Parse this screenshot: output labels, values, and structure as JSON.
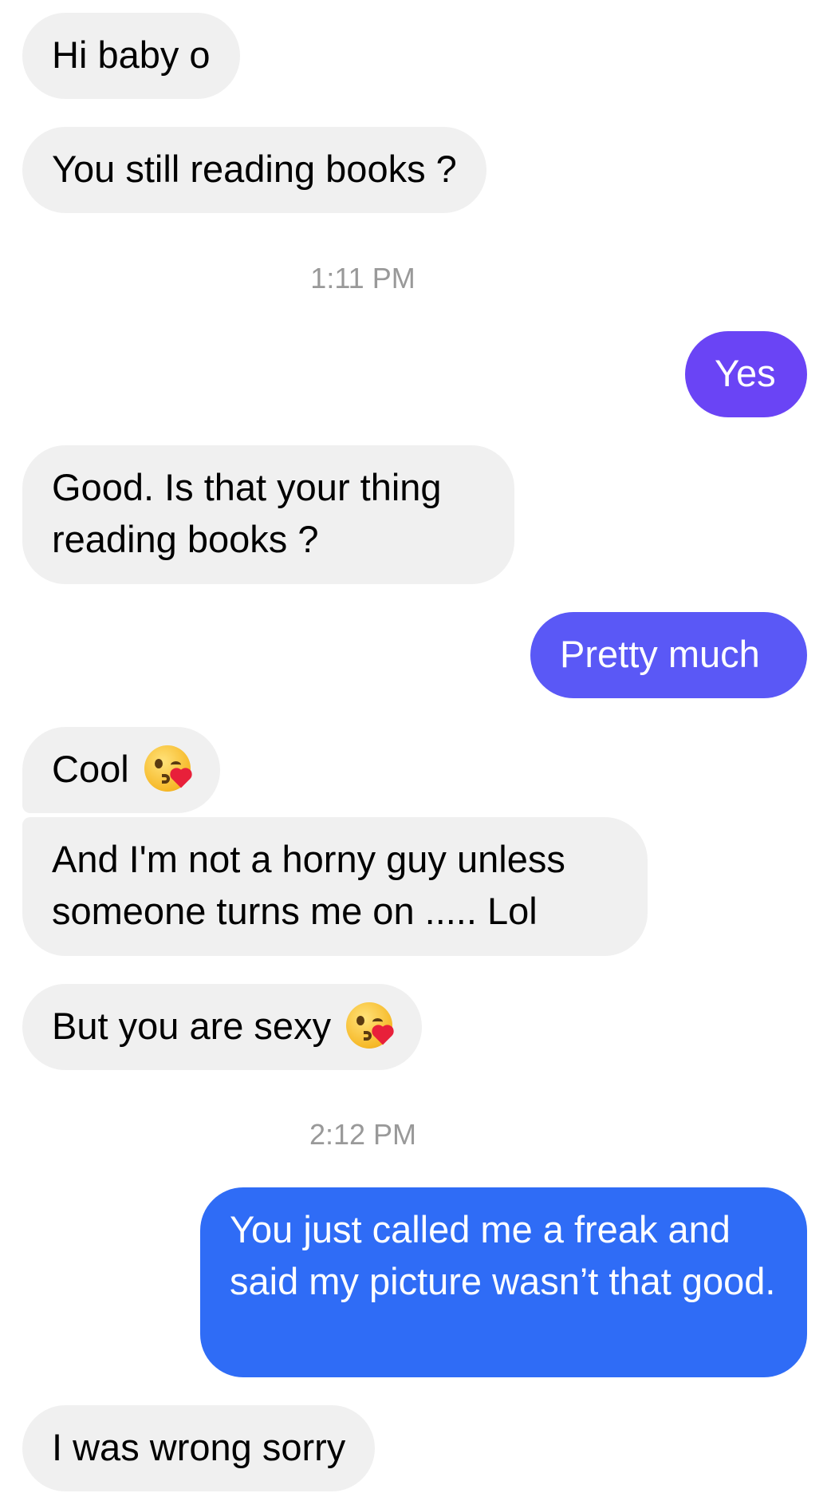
{
  "conversation": {
    "messages": [
      {
        "sender": "them",
        "text": "Hi baby o"
      },
      {
        "sender": "them",
        "text": "You still reading books ?"
      },
      {
        "sender": "me",
        "text": "Yes",
        "color": "#6a44f5"
      },
      {
        "sender": "them",
        "text": "Good. Is that your thing reading books ?"
      },
      {
        "sender": "me",
        "text": "Pretty much",
        "color": "#5a58f6"
      },
      {
        "sender": "them",
        "text": "Cool",
        "emoji": "kissing-face-with-heart-icon"
      },
      {
        "sender": "them",
        "text": "And I'm not a horny guy unless someone turns me on ..... Lol"
      },
      {
        "sender": "them",
        "text": "But you are sexy",
        "emoji": "kissing-face-with-heart-icon"
      },
      {
        "sender": "me",
        "text": "You just called me a freak and said my picture wasn’t that good.",
        "color": "#2f6cf6"
      },
      {
        "sender": "them",
        "text": "I was wrong sorry"
      }
    ],
    "timestamps": [
      "1:11 PM",
      "2:12 PM"
    ]
  },
  "colors": {
    "incoming_bubble": "#f0f0f0",
    "timestamp_text": "#999999"
  }
}
